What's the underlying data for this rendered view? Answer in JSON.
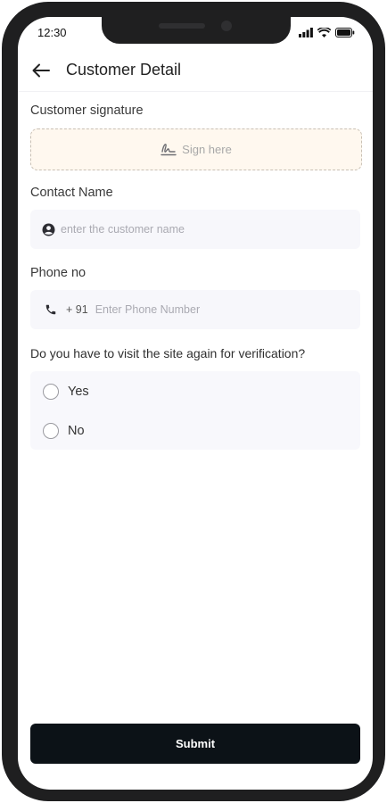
{
  "status_bar": {
    "time": "12:30",
    "icons": [
      "signal-icon",
      "wifi-icon",
      "battery-icon"
    ]
  },
  "header": {
    "back_icon": "arrow-left-icon",
    "title": "Customer Detail"
  },
  "signature": {
    "label": "Customer signature",
    "placeholder": "Sign here",
    "icon": "signature-icon",
    "background": "#fff8ef"
  },
  "contact": {
    "label": "Contact Name",
    "icon": "person-icon",
    "placeholder": "enter the customer name",
    "value": ""
  },
  "phone": {
    "label": "Phone no",
    "icon": "phone-icon",
    "country_code": "+ 91",
    "placeholder": "Enter Phone Number",
    "value": ""
  },
  "verification": {
    "question": "Do you  have to visit the site again for verification?",
    "options": [
      {
        "label": "Yes",
        "selected": false
      },
      {
        "label": "No",
        "selected": false
      }
    ]
  },
  "submit": {
    "label": "Submit",
    "color": "#0c1217"
  }
}
